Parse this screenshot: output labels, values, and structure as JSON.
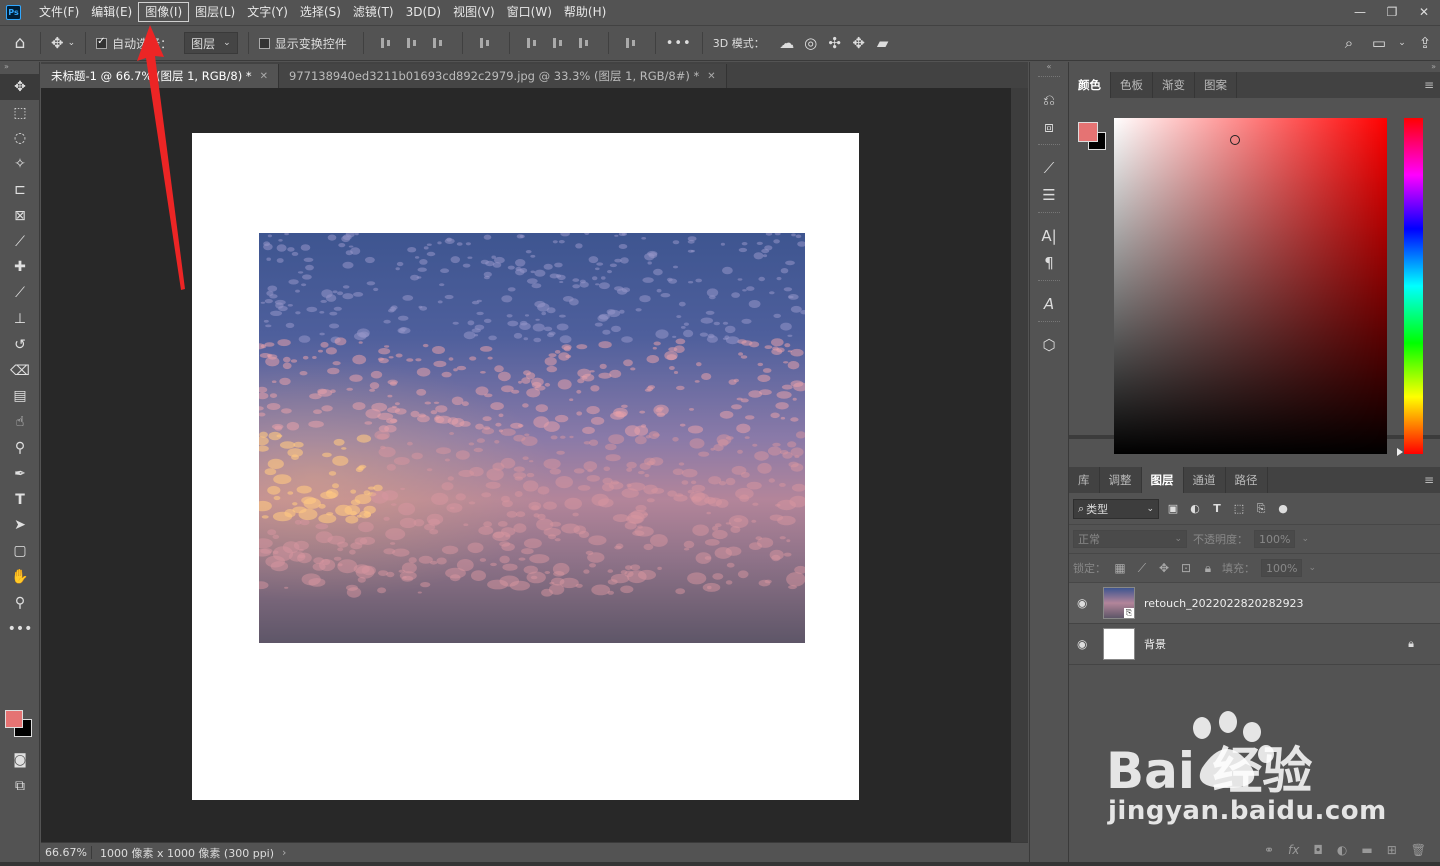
{
  "menubar": {
    "logo": "Ps",
    "items": [
      "文件(F)",
      "编辑(E)",
      "图像(I)",
      "图层(L)",
      "文字(Y)",
      "选择(S)",
      "滤镜(T)",
      "3D(D)",
      "视图(V)",
      "窗口(W)",
      "帮助(H)"
    ],
    "active_index": 2
  },
  "options": {
    "auto_select_label": "自动选择：",
    "auto_select_checked": true,
    "target_select": "图层",
    "show_transform_label": "显示变换控件",
    "show_transform_checked": false,
    "more": "•••",
    "mode_3d_label": "3D 模式："
  },
  "tabs": [
    {
      "label": "未标题-1 @ 66.7% (图层 1, RGB/8) *",
      "active": true
    },
    {
      "label": "977138940ed3211b01693cd892c2979.jpg @ 33.3% (图层 1, RGB/8#) *",
      "active": false
    }
  ],
  "status": {
    "zoom": "66.67%",
    "doc_size": "1000 像素 x 1000 像素 (300 ppi)"
  },
  "color_panel": {
    "tabs": [
      "颜色",
      "色板",
      "渐变",
      "图案"
    ],
    "active_tab": 0,
    "foreground": "#e57373",
    "background": "#000000"
  },
  "layers_panel": {
    "tabs": [
      "库",
      "调整",
      "图层",
      "通道",
      "路径"
    ],
    "active_tab": 2,
    "filter_label": "类型",
    "blend_mode": "正常",
    "opacity_label": "不透明度：",
    "opacity_value": "100%",
    "lock_label": "锁定：",
    "fill_label": "填充：",
    "fill_value": "100%",
    "layers": [
      {
        "name": "retouch_2022022820282923",
        "visible": true,
        "selected": true,
        "locked": false
      },
      {
        "name": "背景",
        "visible": true,
        "selected": false,
        "locked": true
      }
    ]
  },
  "watermark": {
    "brand": "Bai 经验",
    "url": "jingyan.baidu.com"
  }
}
